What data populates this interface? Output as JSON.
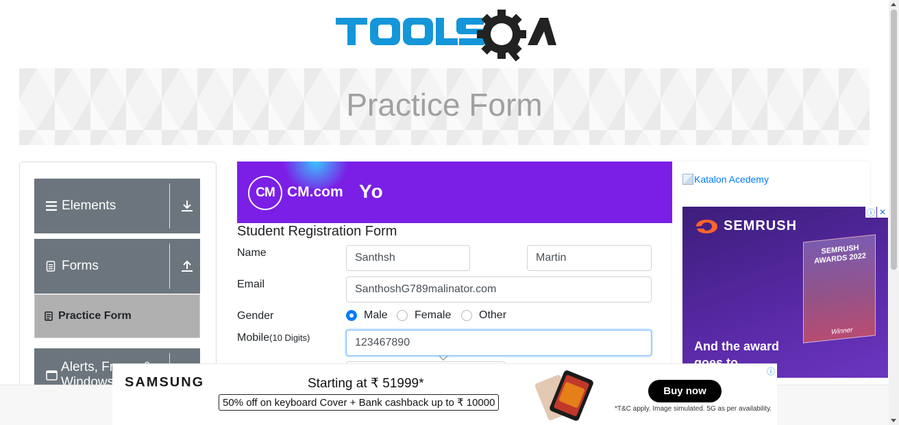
{
  "logo": {
    "brand_text": "TOOLSQA"
  },
  "banner": {
    "title": "Practice Form"
  },
  "sidebar": {
    "groups": [
      {
        "label": "Elements",
        "icon": "menu-icon",
        "arrow": "download-arrow-icon"
      },
      {
        "label": "Forms",
        "icon": "document-icon",
        "arrow": "upload-arrow-icon"
      },
      {
        "label": "Alerts, Frame & Windows",
        "icon": "window-icon",
        "arrow": "download-arrow-icon"
      }
    ],
    "active_item": {
      "label": "Practice Form",
      "icon": "form-icon"
    }
  },
  "top_ad": {
    "logo_initials": "CM",
    "brand": "CM.com",
    "tagline": "Yo"
  },
  "form": {
    "title": "Student Registration Form",
    "name_label": "Name",
    "first_name": "Santhsh",
    "last_name": "Martin",
    "email_label": "Email",
    "email": "SanthoshG789malinator.com",
    "gender_label": "Gender",
    "gender_options": [
      "Male",
      "Female",
      "Other"
    ],
    "gender_selected": "Male",
    "mobile_label": "Mobile",
    "mobile_hint": "(10 Digits)",
    "mobile": "123467890"
  },
  "right": {
    "katalon_alt": "Katalon Acedemy",
    "semrush": {
      "brand": "SEMRUSH",
      "award_text": "SEMRUSH AWARDS 2022",
      "winner": "Winner",
      "headline": "And the award goes to",
      "info_icon": "info-icon",
      "close_icon": "close-icon"
    }
  },
  "bottom_ad": {
    "brand": "SAMSUNG",
    "starting": "Starting at ₹ 51999*",
    "offer": "50% off on keyboard Cover + Bank cashback up to ₹ 10000",
    "cta": "Buy now",
    "disclaimer": "*T&C apply. Image simulated. 5G as per availability."
  },
  "colors": {
    "accent": "#007bff",
    "sidebar_group": "#6c757d",
    "cm_purple": "#7b1fe6",
    "logo_blue": "#1496d9"
  }
}
